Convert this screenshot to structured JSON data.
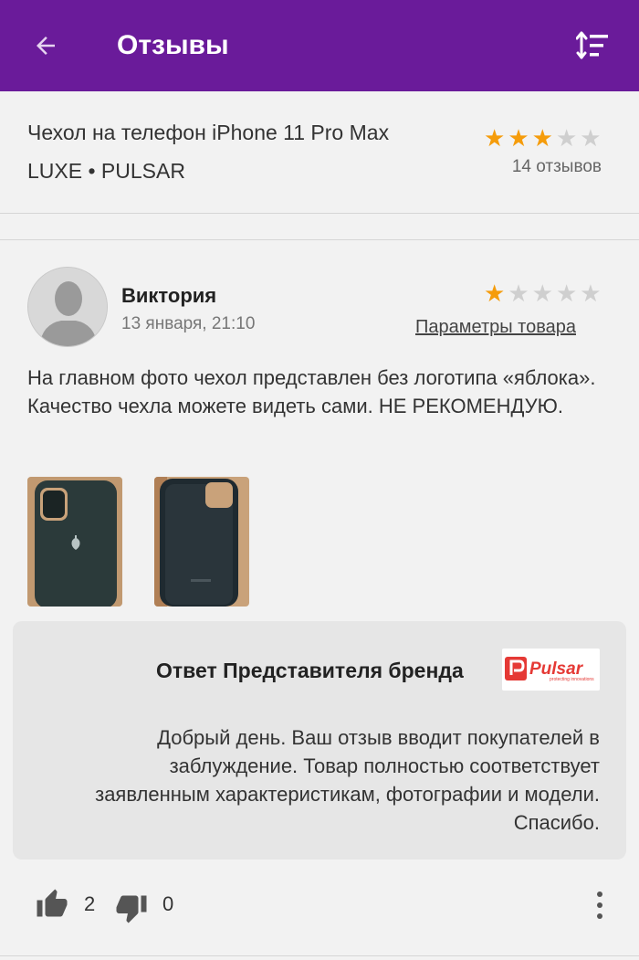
{
  "appbar": {
    "title": "Отзывы",
    "back_icon": "arrow-back-icon",
    "sort_icon": "sort-icon",
    "color": "#6a1b9a"
  },
  "product": {
    "name": "Чехол на телефон iPhone 11 Pro Max",
    "brand_line": "LUXE • PULSAR",
    "rating": 3,
    "max_rating": 5,
    "reviews_count": "14 отзывов"
  },
  "review": {
    "author": "Виктория",
    "date": "13 января, 21:10",
    "rating": 1,
    "max_rating": 5,
    "params_link": "Параметры товара",
    "text": "На главном фото чехол представлен без логотипа «яблока». Качество чехла можете видеть сами. НЕ РЕКОМЕНДУЮ.",
    "photos": [
      "phone-case-back-photo",
      "phone-case-inside-photo"
    ]
  },
  "brand_answer": {
    "title": "Ответ Представителя бренда",
    "logo_text": "Pulsar",
    "logo_tagline": "protecting innovations",
    "text": "Добрый день. Ваш отзыв вводит покупателей в заблуждение. Товар полностью соответствует заявленным характеристикам, фотографии и модели. Спасибо."
  },
  "actions": {
    "likes": "2",
    "dislikes": "0"
  },
  "colors": {
    "accent": "#6a1b9a",
    "star": "#f59c0b",
    "star_off": "#cfcfcf",
    "logo_red": "#e53935"
  }
}
